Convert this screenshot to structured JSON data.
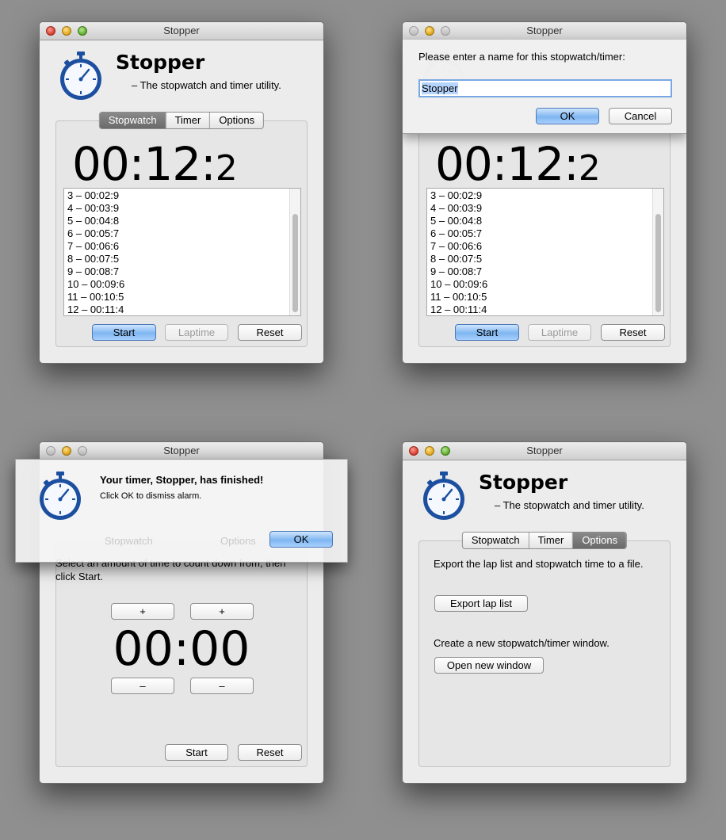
{
  "app": {
    "title": "Stopper",
    "name": "Stopper",
    "subtitle": "– The stopwatch and timer utility."
  },
  "tabs": {
    "stopwatch": "Stopwatch",
    "timer": "Timer",
    "options": "Options"
  },
  "stopwatch": {
    "time_main": "00:12:",
    "time_frac": "2",
    "laps": [
      "3 – 00:02:9",
      "4 – 00:03:9",
      "5 – 00:04:8",
      "6 – 00:05:7",
      "7 – 00:06:6",
      "8 – 00:07:5",
      "9 – 00:08:7",
      "10 – 00:09:6",
      "11 – 00:10:5",
      "12 – 00:11:4"
    ],
    "start_label": "Start",
    "laptime_label": "Laptime",
    "reset_label": "Reset"
  },
  "rename_sheet": {
    "prompt": "Please enter a name for this stopwatch/timer:",
    "value": "Stopper",
    "ok_label": "OK",
    "cancel_label": "Cancel"
  },
  "alert": {
    "title": "Your timer, Stopper, has finished!",
    "message": "Click OK to dismiss alarm.",
    "ok_label": "OK"
  },
  "timer": {
    "description": "Select an amount of time to count down from, then click Start.",
    "digits": "00:00",
    "plus": "+",
    "minus": "–",
    "start_label": "Start",
    "reset_label": "Reset"
  },
  "options": {
    "export_text": "Export the lap list and stopwatch time to a file.",
    "export_button": "Export lap list",
    "new_window_text": "Create a new stopwatch/timer window.",
    "new_window_button": "Open new window"
  },
  "colors": {
    "desktop": "#8f8f8f",
    "window_bg": "#ececec",
    "default_button": "#7fb6f0",
    "active_tab": "#6a6a6a",
    "icon_blue": "#1c4fa0"
  },
  "icons": [
    "stopwatch-icon",
    "close-icon",
    "minimize-icon",
    "zoom-icon"
  ]
}
